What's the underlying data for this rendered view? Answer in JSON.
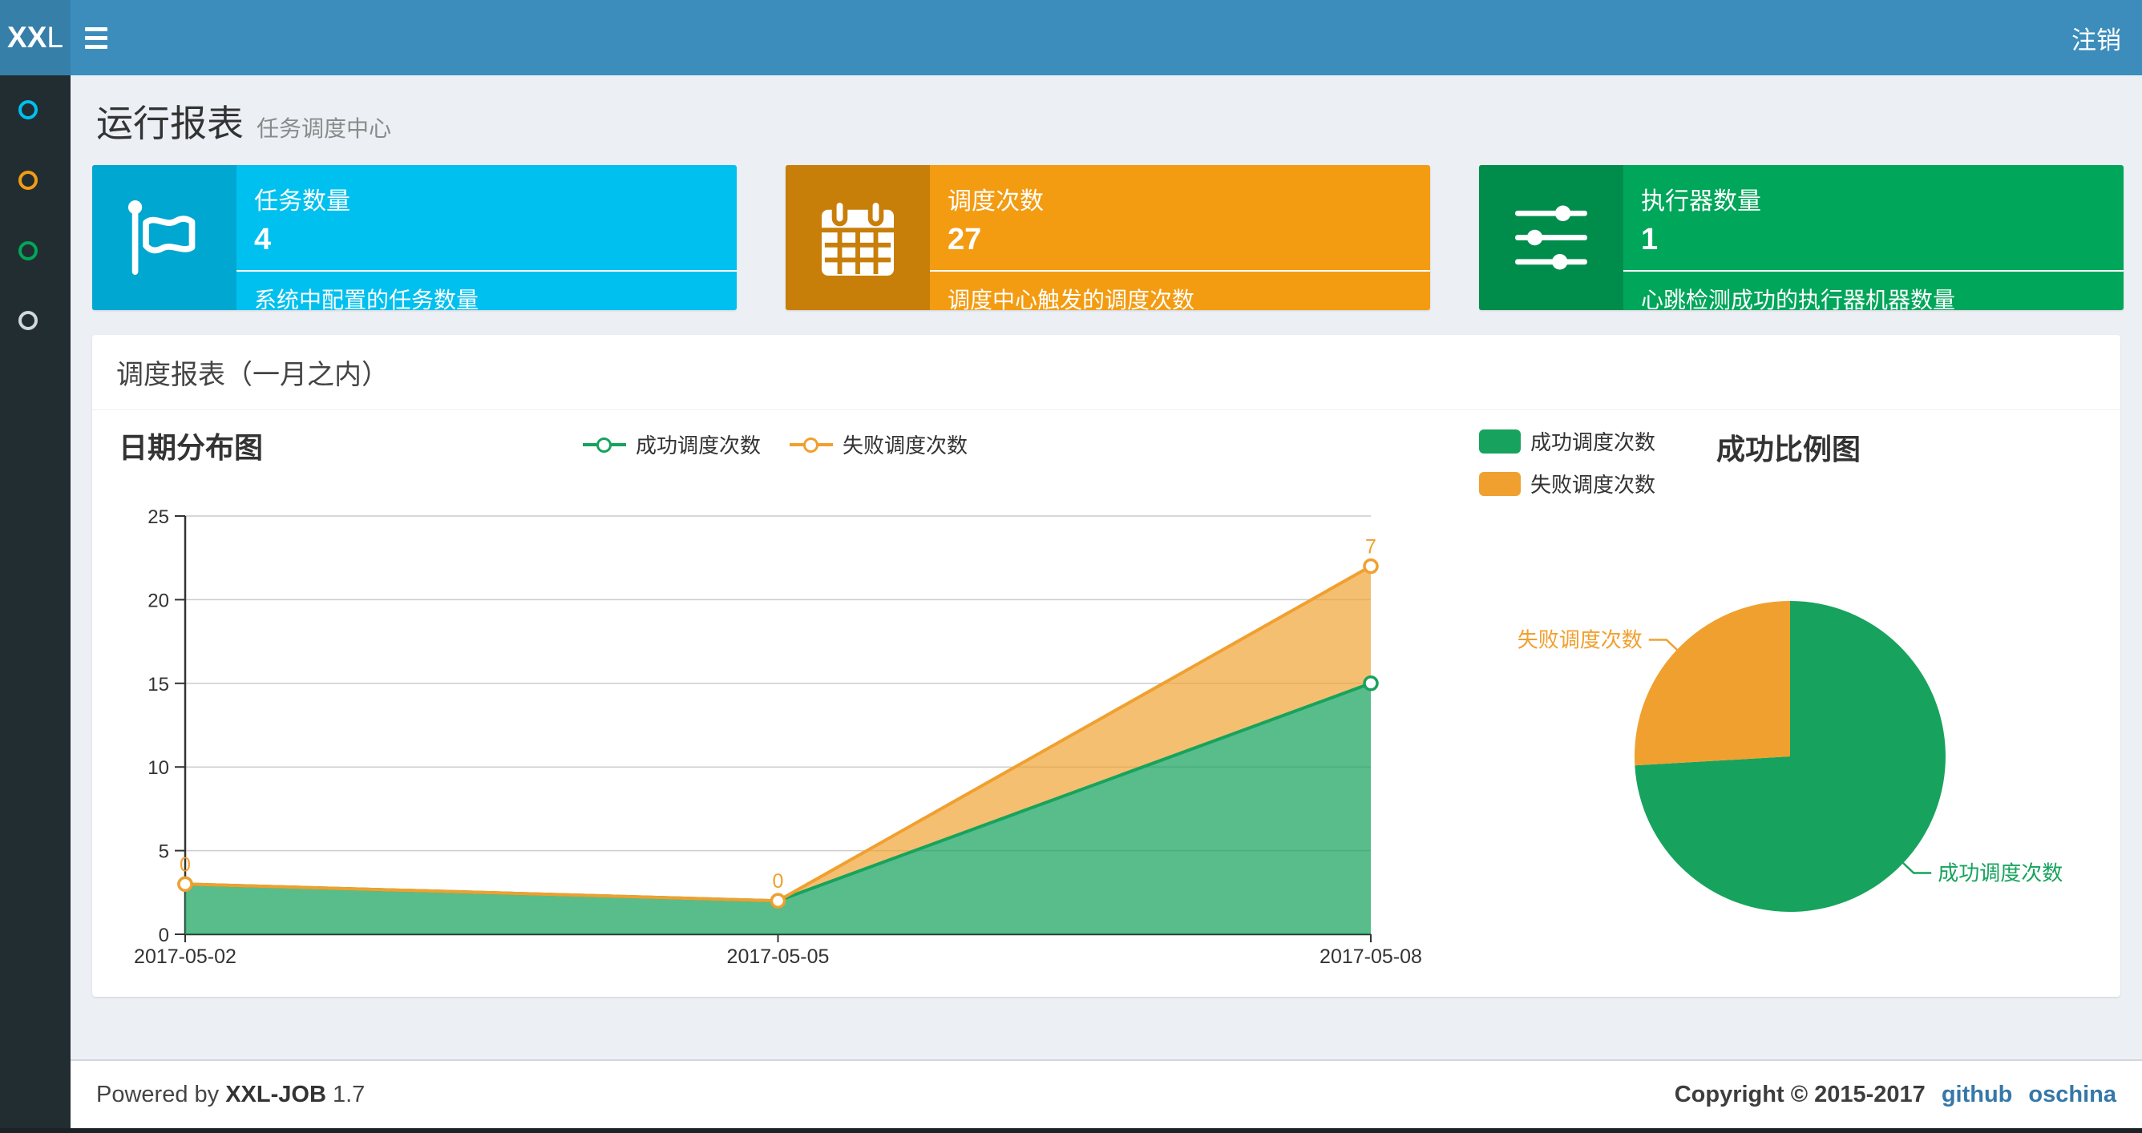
{
  "header": {
    "logo_bold": "XX",
    "logo_light": "L",
    "logout_label": "注销"
  },
  "sidebar": {
    "items": [
      {
        "icon": "circle-icon",
        "color": "#00c0ef"
      },
      {
        "icon": "circle-icon",
        "color": "#f39c12"
      },
      {
        "icon": "circle-icon",
        "color": "#00a65a"
      },
      {
        "icon": "circle-icon",
        "color": "#d2d6de"
      }
    ]
  },
  "page": {
    "title": "运行报表",
    "subtitle": "任务调度中心"
  },
  "stat_cards": [
    {
      "title": "任务数量",
      "value": "4",
      "desc": "系统中配置的任务数量",
      "color": "#00c0ef",
      "icon_bg": "#00a7d0",
      "icon": "flag-icon"
    },
    {
      "title": "调度次数",
      "value": "27",
      "desc": "调度中心触发的调度次数",
      "color": "#f39c12",
      "icon_bg": "#c87f0a",
      "icon": "calendar-icon"
    },
    {
      "title": "执行器数量",
      "value": "1",
      "desc": "心跳检测成功的执行器机器数量",
      "color": "#00a65a",
      "icon_bg": "#008d4c",
      "icon": "sliders-icon"
    }
  ],
  "panel": {
    "title": "调度报表（一月之内）"
  },
  "chart_data": [
    {
      "type": "area",
      "title": "日期分布图",
      "stacked": true,
      "grid": true,
      "legend_position": "top-center",
      "categories": [
        "2017-05-02",
        "2017-05-05",
        "2017-05-08"
      ],
      "ylim": [
        0,
        25
      ],
      "yticks": [
        0,
        5,
        10,
        15,
        20,
        25
      ],
      "series": [
        {
          "name": "成功调度次数",
          "color": "#17a35d",
          "fill": "rgba(23,163,93,0.72)",
          "values": [
            3,
            2,
            15
          ]
        },
        {
          "name": "失败调度次数",
          "color": "#f0a02f",
          "fill": "rgba(240,160,47,0.68)",
          "values": [
            0,
            0,
            7
          ],
          "point_labels": [
            "0",
            "0",
            "7"
          ]
        }
      ]
    },
    {
      "type": "pie",
      "title": "成功比例图",
      "legend_position": "left",
      "slices": [
        {
          "name": "成功调度次数",
          "value": 20,
          "color": "#17a35d"
        },
        {
          "name": "失败调度次数",
          "value": 7,
          "color": "#f0a02f"
        }
      ]
    }
  ],
  "footer": {
    "powered_prefix": "Powered by",
    "product": "XXL-JOB",
    "version": "1.7",
    "copyright": "Copyright © 2015-2017",
    "links": [
      "github",
      "oschina"
    ]
  }
}
